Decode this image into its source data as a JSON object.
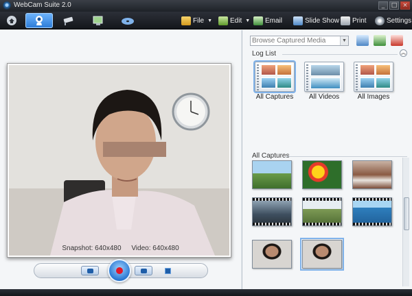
{
  "window": {
    "title": "WebCam Suite 2.0",
    "controls": [
      "_",
      "□",
      "×"
    ]
  },
  "toolbar": {
    "mode_tabs": [
      {
        "icon": "home-icon"
      },
      {
        "icon": "webcam-icon",
        "active": true
      },
      {
        "icon": "security-camera-icon"
      },
      {
        "icon": "video-chat-icon"
      },
      {
        "icon": "media-disc-icon"
      }
    ],
    "menu": [
      {
        "label": "File",
        "icon": "folder-icon",
        "dropdown": true
      },
      {
        "label": "Edit",
        "icon": "edit-icon",
        "dropdown": true
      },
      {
        "label": "Email",
        "icon": "email-icon"
      },
      {
        "label": "Slide Show",
        "icon": "slideshow-icon"
      },
      {
        "label": "Print",
        "icon": "printer-icon"
      },
      {
        "label": "Settings",
        "icon": "gear-icon"
      }
    ]
  },
  "preview": {
    "snapshot_label": "Snapshot: 640x480",
    "video_label": "Video: 640x480"
  },
  "browse": {
    "placeholder": "Browse Captured Media"
  },
  "log_list": {
    "title": "Log List",
    "items": [
      {
        "label": "All Captures",
        "selected": true
      },
      {
        "label": "All Videos"
      },
      {
        "label": "All Images"
      }
    ]
  },
  "captures": {
    "title": "All Captures",
    "thumbnails": [
      {
        "kind": "landscape-image"
      },
      {
        "kind": "flower-image"
      },
      {
        "kind": "waterfall-image"
      },
      {
        "kind": "city-video"
      },
      {
        "kind": "field-video"
      },
      {
        "kind": "sea-video"
      },
      {
        "kind": "webcam-snapshot"
      },
      {
        "kind": "webcam-snapshot",
        "selected": true
      }
    ]
  },
  "colors": {
    "accent": "#2b7ad6",
    "record": "#e0182a",
    "toolbar_bg": "#1e2228"
  }
}
